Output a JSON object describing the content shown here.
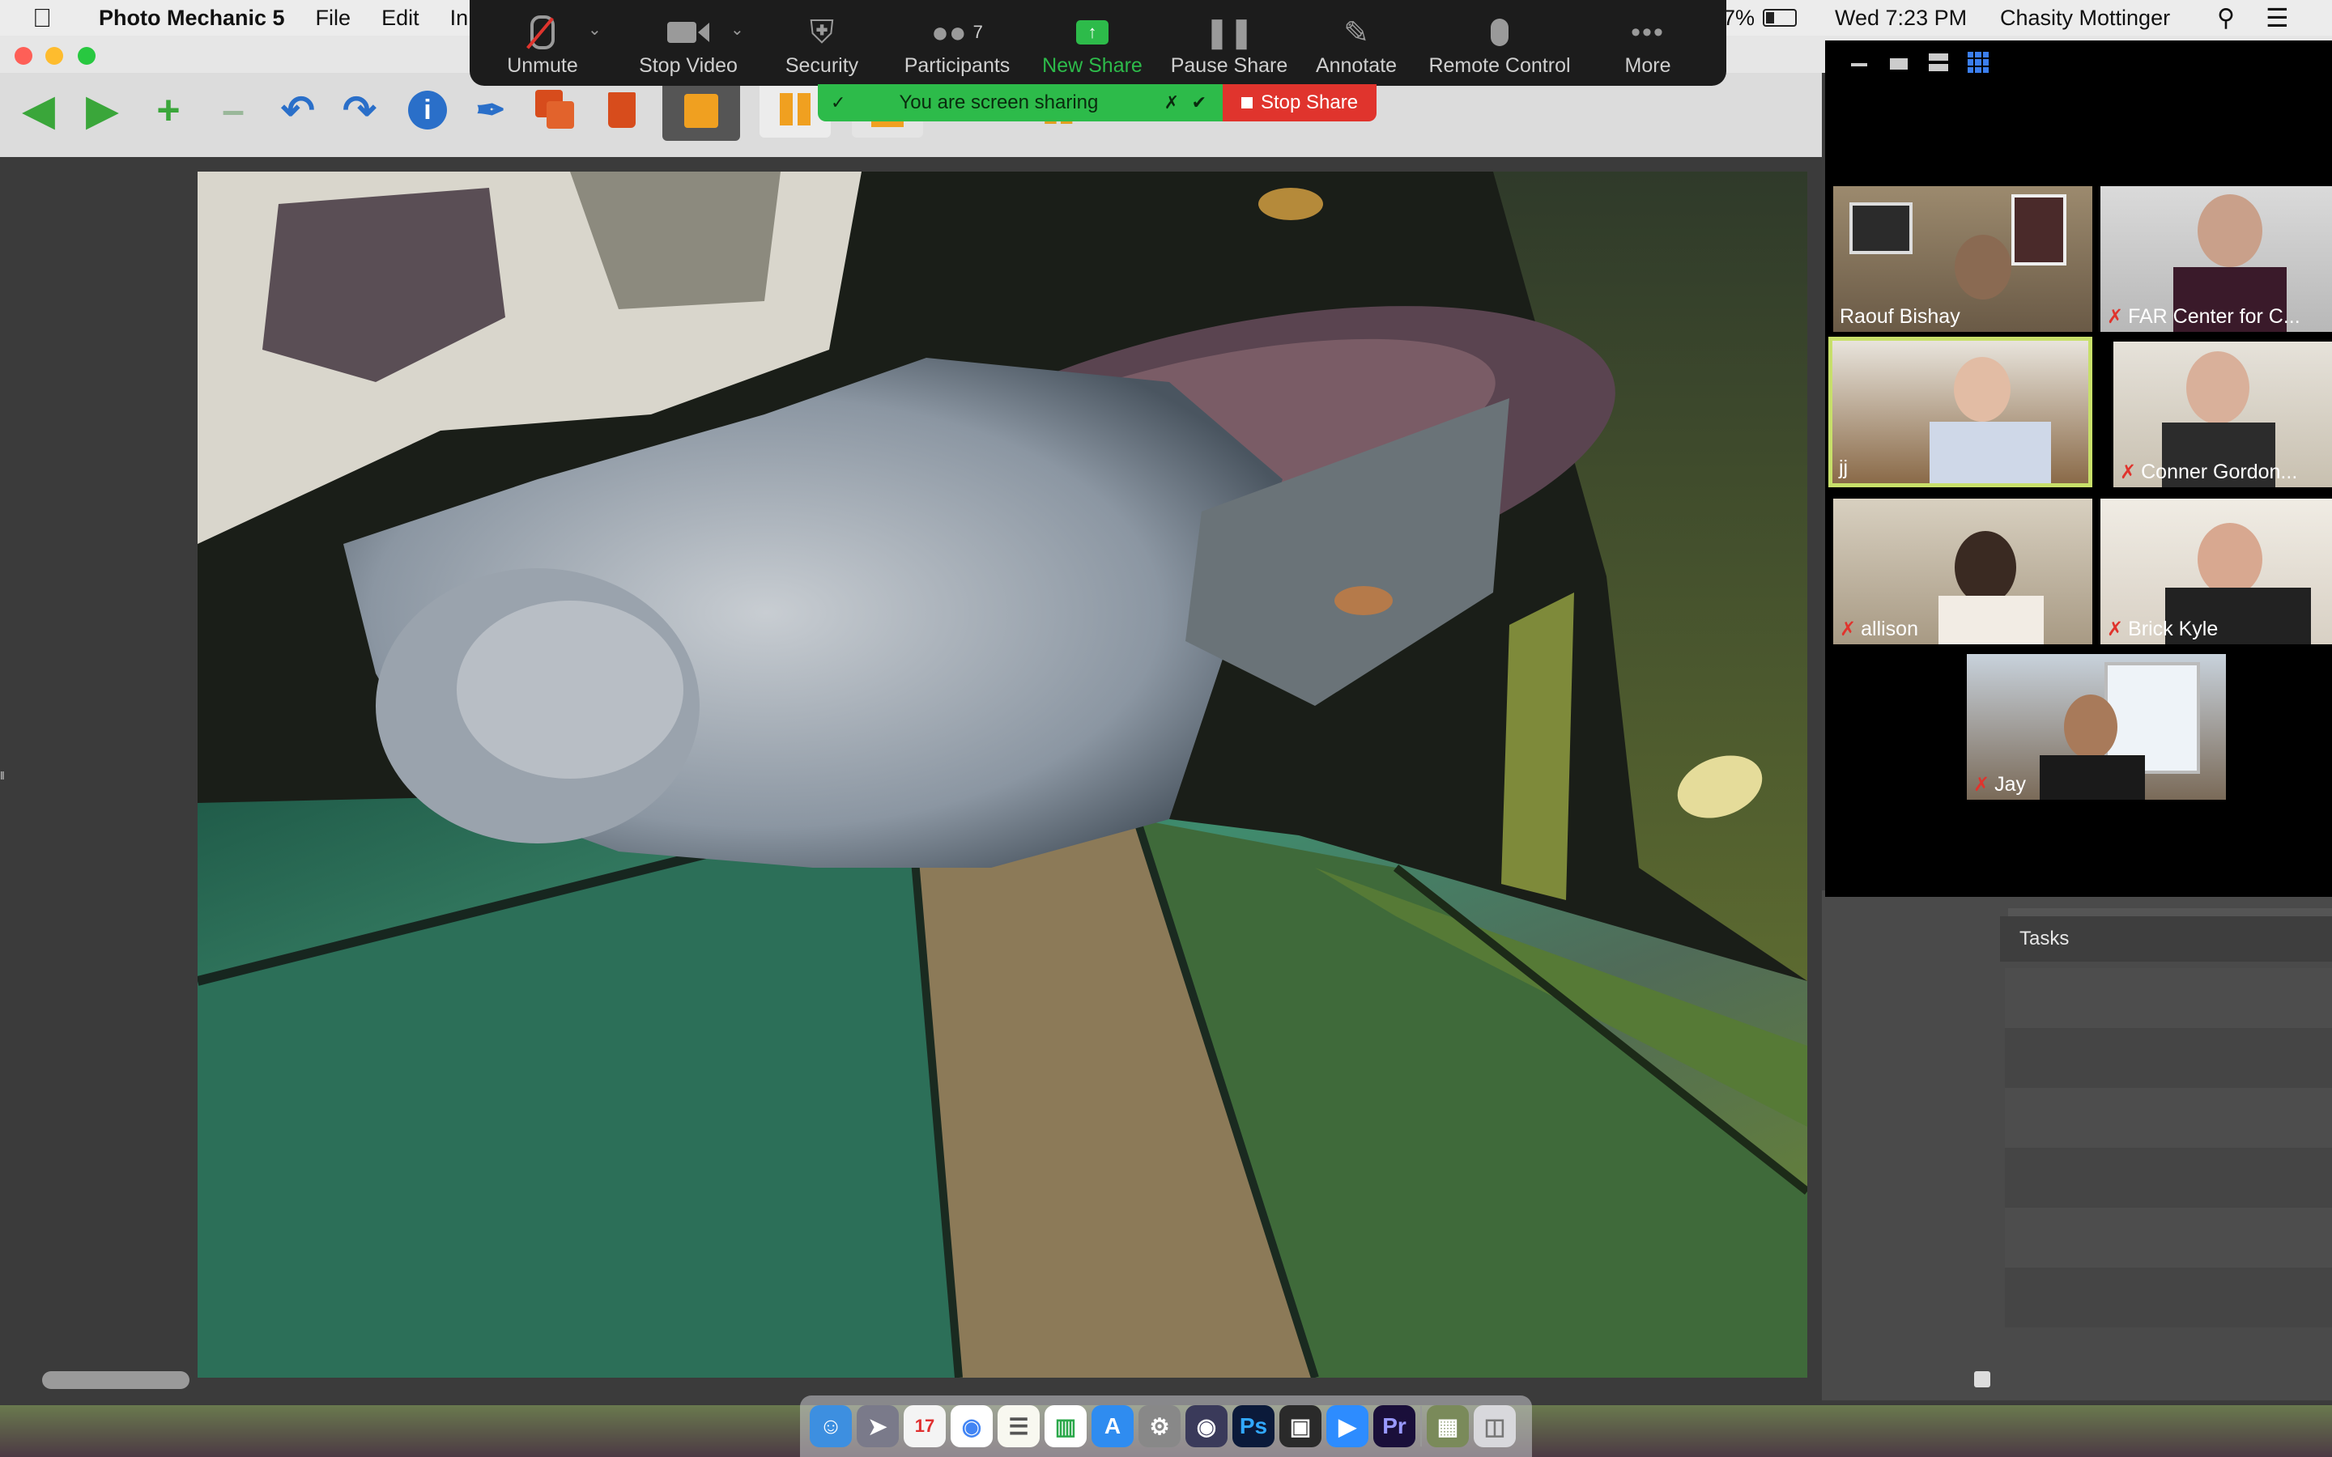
{
  "menubar": {
    "app_name": "Photo Mechanic 5",
    "items": [
      "File",
      "Edit",
      "In"
    ],
    "battery_percent": "7%",
    "clock": "Wed 7:23 PM",
    "user": "Chasity Mottinger"
  },
  "zoom_toolbar": {
    "unmute": "Unmute",
    "stop_video": "Stop Video",
    "security": "Security",
    "participants": "Participants",
    "participant_count": "7",
    "new_share": "New Share",
    "pause_share": "Pause Share",
    "annotate": "Annotate",
    "remote_control": "Remote Control",
    "more": "More"
  },
  "share_banner": {
    "status": "You are screen sharing",
    "stop_share": "Stop Share"
  },
  "gallery": {
    "participants": [
      {
        "name": "Raouf Bishay",
        "muted": false
      },
      {
        "name": "FAR Center for C...",
        "muted": true
      },
      {
        "name": "jj",
        "muted": false,
        "active_speaker": true
      },
      {
        "name": "Conner Gordon...",
        "muted": true
      },
      {
        "name": "allison",
        "muted": true
      },
      {
        "name": "Brick Kyle",
        "muted": true
      },
      {
        "name": "Jay",
        "muted": true
      }
    ]
  },
  "right_panel": {
    "tasks_label": "Tasks"
  },
  "colors": {
    "zoom_green": "#2dbb4a",
    "stop_red": "#e0342d",
    "speaker_highlight": "#c8e06a"
  }
}
